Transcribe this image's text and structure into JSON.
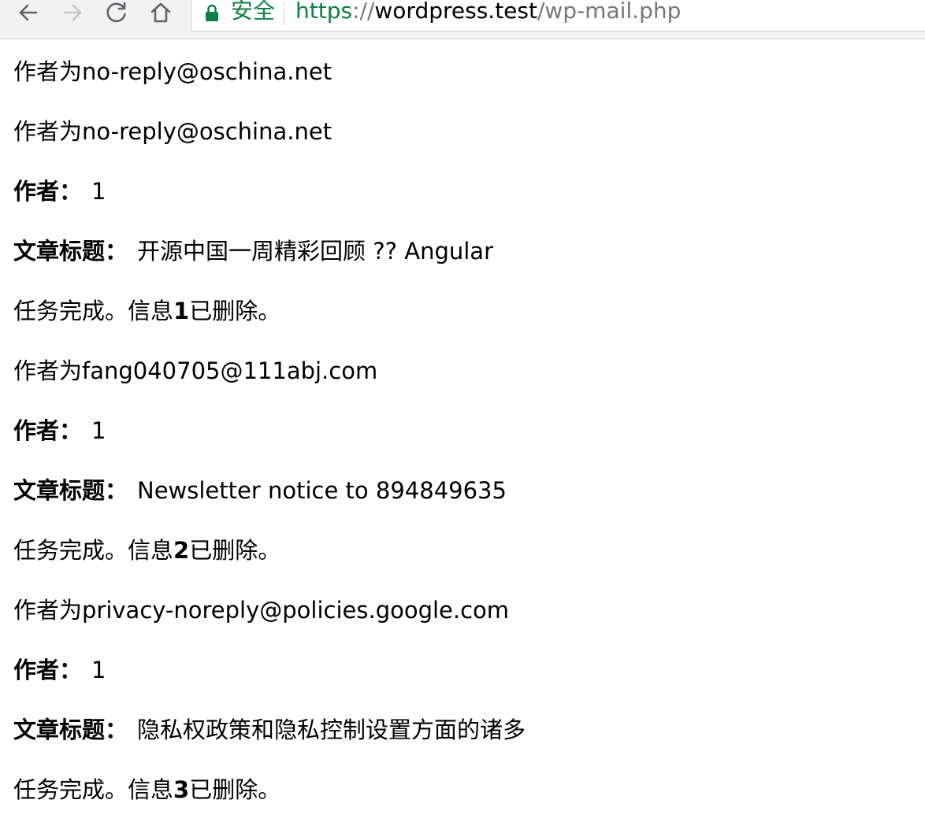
{
  "browser": {
    "security_label": "安全",
    "url": {
      "scheme": "https",
      "separator": "://",
      "host": "wordpress.test",
      "path": "/wp-mail.php"
    },
    "colors": {
      "secure_green": "#0b8043",
      "toolbar_bg": "#f2f2f2",
      "dim_text": "#777777"
    },
    "icons": [
      "back-icon",
      "forward-icon",
      "reload-icon",
      "home-icon",
      "lock-icon"
    ]
  },
  "lines": [
    {
      "text": "作者为no-reply@oschina.net"
    },
    {
      "text": "作者为no-reply@oschina.net"
    },
    {
      "label": "作者：",
      "value": "1"
    },
    {
      "label": "文章标题：",
      "value": "开源中国一周精彩回顾 ?? Angular"
    },
    {
      "prefix": "任务完成。信息",
      "num": "1",
      "suffix": "已删除。"
    },
    {
      "text": "作者为fang040705@111abj.com"
    },
    {
      "label": "作者：",
      "value": "1"
    },
    {
      "label": "文章标题：",
      "value": "Newsletter notice to 894849635"
    },
    {
      "prefix": "任务完成。信息",
      "num": "2",
      "suffix": "已删除。"
    },
    {
      "text": "作者为privacy-noreply@policies.google.com"
    },
    {
      "label": "作者：",
      "value": "1"
    },
    {
      "label": "文章标题：",
      "value": "隐私权政策和隐私控制设置方面的诸多"
    },
    {
      "prefix": "任务完成。信息",
      "num": "3",
      "suffix": "已删除。"
    }
  ]
}
